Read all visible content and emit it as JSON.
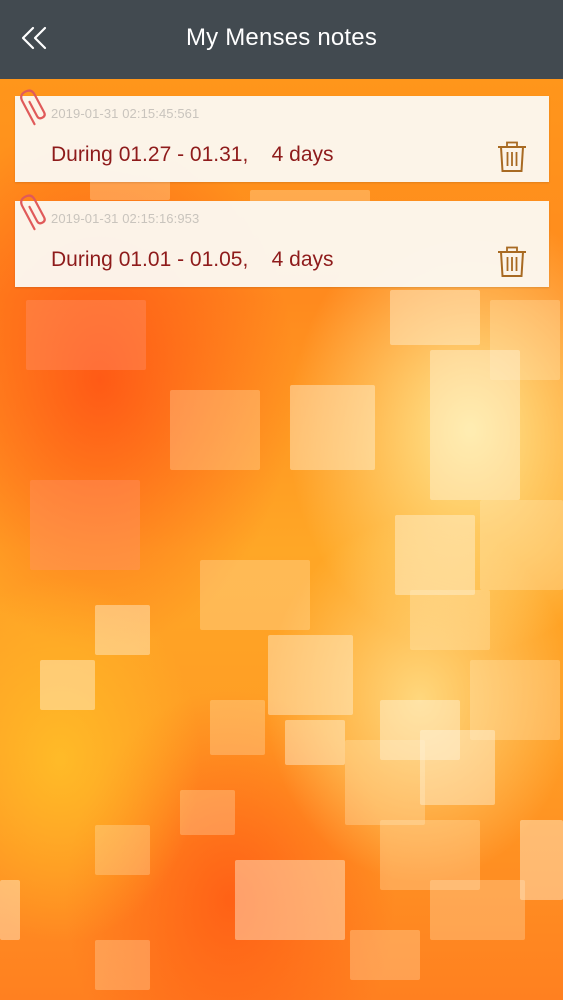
{
  "header": {
    "title": "My Menses notes",
    "back_icon": "double-chevron-left-icon"
  },
  "notes": [
    {
      "timestamp": "2019-01-31 02:15:45:561",
      "period": "During 01.27 - 01.31,    4 days",
      "icon": "paperclip-icon",
      "delete_icon": "trash-icon"
    },
    {
      "timestamp": "2019-01-31 02:15:16:953",
      "period": "During 01.01 - 01.05,    4 days",
      "icon": "paperclip-icon",
      "delete_icon": "trash-icon"
    }
  ],
  "colors": {
    "navbar": "#424a50",
    "note_text": "#8e1b1b",
    "timestamp_text": "#c9c4bd",
    "clip": "#e05a5a",
    "trash": "#a86a22"
  }
}
